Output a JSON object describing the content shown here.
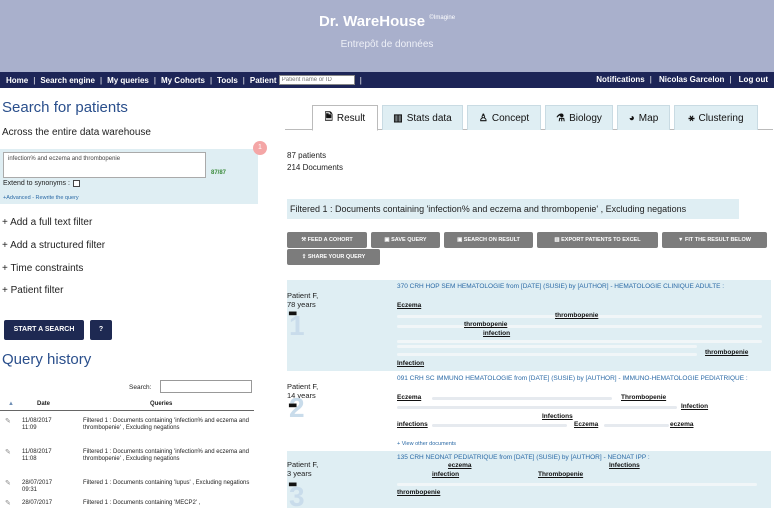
{
  "header": {
    "title": "Dr. WareHouse",
    "title_sup": "©Imagine",
    "subtitle": "Entrepôt de données"
  },
  "nav": {
    "items": [
      "Home",
      "Search engine",
      "My queries",
      "My Cohorts",
      "Tools"
    ],
    "patient_label": "Patient",
    "patient_placeholder": "Patient name or ID",
    "right_items": [
      "Notifications",
      "Nicolas Garcelon",
      "Log out"
    ]
  },
  "left": {
    "title": "Search for patients",
    "subtitle": "Across the entire data warehouse",
    "query_text": "infection% and eczema and thrombopenie",
    "query_count": "87/87",
    "synonyms_label": "Extend to synonyms :",
    "advanced_link": "+Advanced - Rewrite the query",
    "badge": "1",
    "filters": [
      "+ Add a full text filter",
      "+ Add a structured filter",
      "+ Time constraints",
      "+ Patient filter"
    ],
    "start_button": "START A SEARCH",
    "help_button": "?",
    "history_title": "Query history",
    "search_label": "Search:",
    "col_date": "Date",
    "col_queries": "Queries",
    "sort_icon": "▲",
    "history": [
      {
        "date1": "11/08/2017",
        "date2": "11:09",
        "text": "Filtered 1 : Documents containing 'infection% and eczema and thrombopenie' , Excluding negations"
      },
      {
        "date1": "11/08/2017",
        "date2": "11:08",
        "text": "Filtered 1 : Documents containing 'infection% and eczema and thrombopenie' , Excluding negations"
      },
      {
        "date1": "28/07/2017",
        "date2": "09:31",
        "text": "Filtered 1 : Documents containing 'lupus' , Excluding negations"
      },
      {
        "date1": "28/07/2017",
        "date2": "",
        "text": "Filtered 1 : Documents containing 'MECP2' ,"
      }
    ]
  },
  "tabs": [
    {
      "icon": "document-icon",
      "glyph": "🗎",
      "label": "Result"
    },
    {
      "icon": "stats-icon",
      "glyph": "▥",
      "label": "Stats data"
    },
    {
      "icon": "concept-icon",
      "glyph": "♙",
      "label": "Concept"
    },
    {
      "icon": "biology-icon",
      "glyph": "⚗",
      "label": "Biology"
    },
    {
      "icon": "map-icon",
      "glyph": "◕",
      "label": "Map"
    },
    {
      "icon": "clustering-icon",
      "glyph": "⚹",
      "label": "Clustering"
    }
  ],
  "summary": {
    "patients": "87 patients",
    "documents": "214 Documents",
    "filter_text": "Filtered 1 : Documents containing 'infection% and eczema and thrombopenie' , Excluding negations"
  },
  "actions": [
    "FEED A COHORT",
    "SAVE QUERY",
    "SEARCH ON RESULT",
    "EXPORT PATIENTS TO EXCEL",
    "FIT THE RESULT BELOW",
    "SHARE YOUR QUERY"
  ],
  "results": [
    {
      "patient": "Patient F,",
      "age": "78 years",
      "num": "1",
      "title": "370 CRH HOP SEM HEMATOLOGIE from [DATE] (SUSIE) by [AUTHOR] - HEMATOLOGIE CLINIQUE ADULTE :",
      "keywords": [
        "Eczema",
        "thrombopenie",
        "thrombopenie",
        "infection",
        "thrombopenie",
        "Infection"
      ]
    },
    {
      "patient": "Patient F,",
      "age": "14 years",
      "num": "2",
      "title": "091 CRH SC IMMUNO HEMATOLOGIE from [DATE] (SUSIE) by [AUTHOR] - IMMUNO-HEMATOLOGIE PEDIATRIQUE :",
      "keywords": [
        "Eczema",
        "Thrombopenie",
        "Infection",
        "Infections",
        "infections",
        "Eczema",
        "eczema"
      ]
    },
    {
      "patient": "Patient F,",
      "age": "3 years",
      "num": "3",
      "title": "135 CRH NEONAT PEDIATRIQUE from [DATE] (SUSIE) by [AUTHOR] - NEONAT IPP :",
      "keywords": [
        "eczema",
        "Infections",
        "infection",
        "Thrombopenie",
        "thrombopenie"
      ]
    }
  ],
  "view_more": "+ View other documents"
}
